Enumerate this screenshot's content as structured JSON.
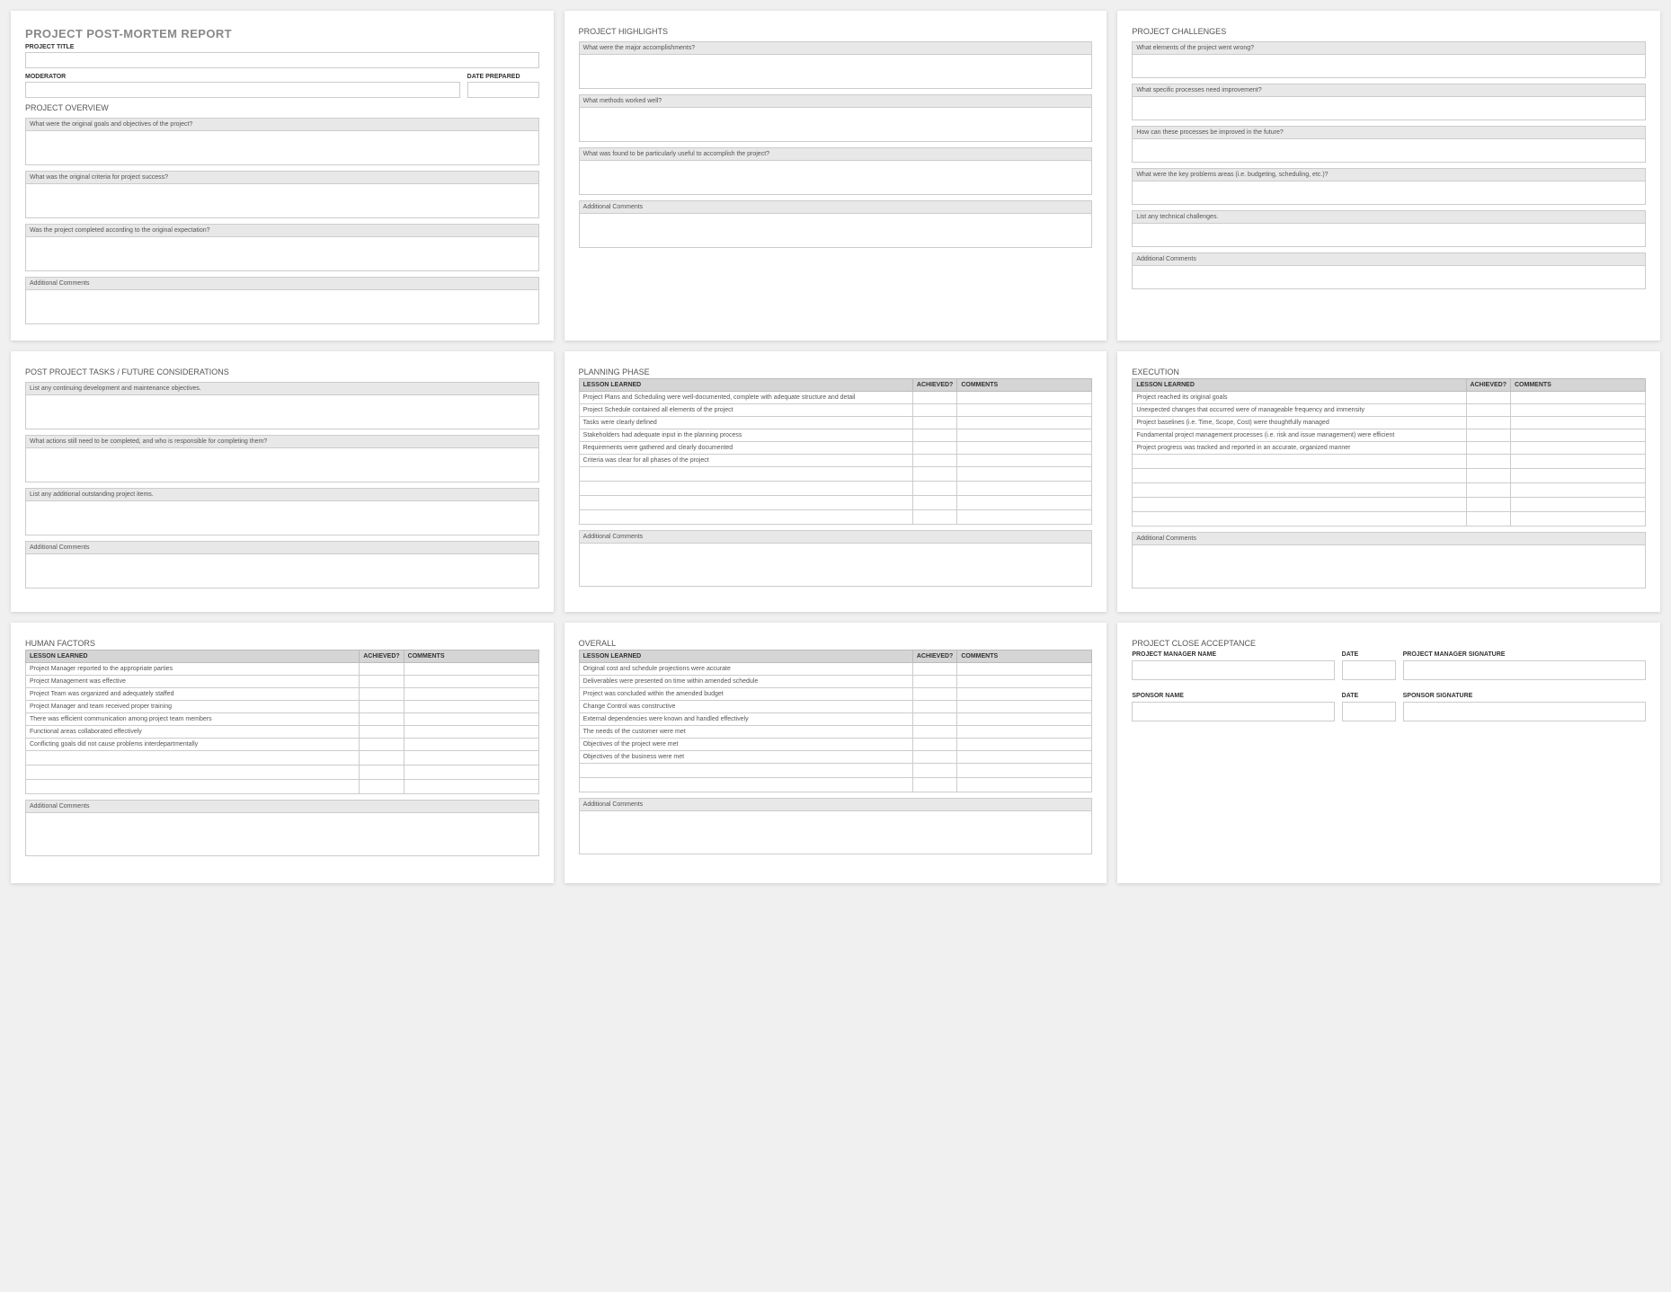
{
  "card1": {
    "title": "PROJECT POST-MORTEM REPORT",
    "project_title_label": "PROJECT TITLE",
    "moderator_label": "MODERATOR",
    "date_prepared_label": "DATE PREPARED",
    "overview_title": "PROJECT OVERVIEW",
    "q1": "What were the original goals and objectives of the project?",
    "q2": "What was the original criteria for project success?",
    "q3": "Was the project completed according to the original expectation?",
    "addl": "Additional Comments"
  },
  "card2": {
    "title": "PROJECT HIGHLIGHTS",
    "q1": "What were the major accomplishments?",
    "q2": "What methods worked well?",
    "q3": "What was found to be particularly useful to accomplish the project?",
    "addl": "Additional Comments"
  },
  "card3": {
    "title": "PROJECT CHALLENGES",
    "q1": "What elements of the project went wrong?",
    "q2": "What specific processes need improvement?",
    "q3": "How can these processes be improved in the future?",
    "q4": "What were the key problems areas (i.e. budgeting, scheduling, etc.)?",
    "q5": "List any technical challenges.",
    "addl": "Additional Comments"
  },
  "card4": {
    "title": "POST PROJECT TASKS / FUTURE CONSIDERATIONS",
    "q1": "List any continuing development and maintenance objectives.",
    "q2": "What actions still need to be completed, and who is responsible for completing them?",
    "q3": "List any additional outstanding project items.",
    "addl": "Additional Comments"
  },
  "card5": {
    "title": "PLANNING PHASE",
    "th_lesson": "LESSON LEARNED",
    "th_ach": "ACHIEVED?",
    "th_com": "COMMENTS",
    "rows": [
      "Project Plans and Scheduling were well-documented, complete with adequate structure and detail",
      "Project Schedule contained all elements of the project",
      "Tasks were clearly defined",
      "Stakeholders had adequate input in the planning process",
      "Requirements were gathered and clearly documented",
      "Criteria was clear for all phases of the project",
      "",
      "",
      "",
      ""
    ],
    "addl": "Additional Comments"
  },
  "card6": {
    "title": "EXECUTION",
    "th_lesson": "LESSON LEARNED",
    "th_ach": "ACHIEVED?",
    "th_com": "COMMENTS",
    "rows": [
      "Project reached its original goals",
      "Unexpected changes that occurred were of manageable frequency and immensity",
      "Project baselines (i.e. Time, Scope, Cost) were thoughtfully managed",
      "Fundamental project management processes (i.e. risk and issue management) were efficient",
      "Project progress was tracked and reported in an accurate, organized manner",
      "",
      "",
      "",
      "",
      ""
    ],
    "addl": "Additional Comments"
  },
  "card7": {
    "title": "HUMAN FACTORS",
    "th_lesson": "LESSON LEARNED",
    "th_ach": "ACHIEVED?",
    "th_com": "COMMENTS",
    "rows": [
      "Project Manager reported to the appropriate parties",
      "Project Management was effective",
      "Project Team was organized and adequately staffed",
      "Project Manager and team received proper training",
      "There was efficient communication among project team members",
      "Functional areas collaborated effectively",
      "Conflicting goals did not cause problems interdepartmentally",
      "",
      "",
      ""
    ],
    "addl": "Additional Comments"
  },
  "card8": {
    "title": "OVERALL",
    "th_lesson": "LESSON LEARNED",
    "th_ach": "ACHIEVED?",
    "th_com": "COMMENTS",
    "rows": [
      "Original cost and schedule projections were accurate",
      "Deliverables were presented on time within amended schedule",
      "Project was concluded within the amended budget",
      "Change Control was constructive",
      "External dependencies were known and handled effectively",
      "The needs of the customer were met",
      "Objectives of the project were met",
      "Objectives of the business were met",
      "",
      ""
    ],
    "addl": "Additional Comments"
  },
  "card9": {
    "title": "PROJECT CLOSE ACCEPTANCE",
    "pm_name": "PROJECT MANAGER NAME",
    "date": "DATE",
    "pm_sig": "PROJECT MANAGER SIGNATURE",
    "sp_name": "SPONSOR NAME",
    "sp_sig": "SPONSOR SIGNATURE"
  }
}
